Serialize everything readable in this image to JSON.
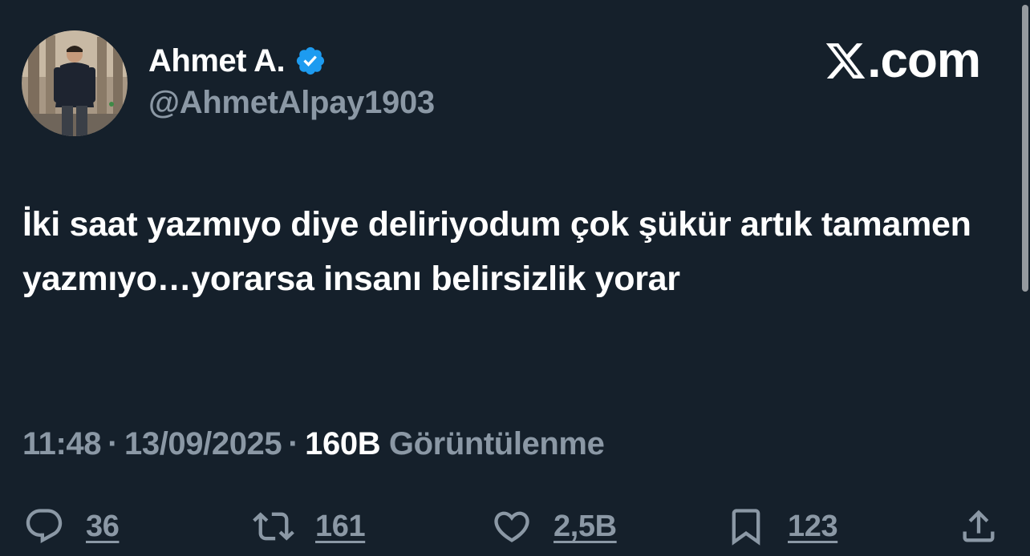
{
  "author": {
    "display_name": "Ahmet A.",
    "handle": "@AhmetAlpay1903",
    "verified": true,
    "verified_color": "#1d9bf0"
  },
  "brand": {
    "text": ".com",
    "logo_icon": "x-logo-icon"
  },
  "tweet": {
    "text": "İki saat yazmıyo diye deliriyodum çok şükür artık tamamen yazmıyo…yorarsa insanı belirsizlik yorar"
  },
  "meta": {
    "time": "11:48",
    "date": "13/09/2025",
    "separator": "·",
    "views_count": "160B",
    "views_label": "Görüntülenme"
  },
  "actions": {
    "reply": {
      "icon": "reply-icon",
      "count": "36"
    },
    "retweet": {
      "icon": "retweet-icon",
      "count": "161"
    },
    "like": {
      "icon": "heart-icon",
      "count": "2,5B"
    },
    "bookmark": {
      "icon": "bookmark-icon",
      "count": "123"
    },
    "share": {
      "icon": "share-icon"
    }
  },
  "colors": {
    "background": "#15202b",
    "primary_text": "#ffffff",
    "secondary_text": "#8b98a5"
  }
}
